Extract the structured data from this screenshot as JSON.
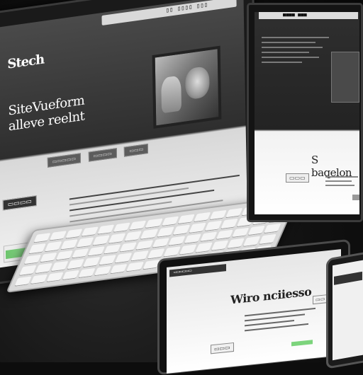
{
  "main_monitor": {
    "url_text": "▯▯ ▯▯▯▯ ▯▯▯",
    "logo": "Stech",
    "headline_1": "SiteVueform",
    "headline_2": "alleve reelnt",
    "buttons": [
      "▭▭▭▭▭",
      "▭▭▭▭",
      "▭▭▭"
    ],
    "nav_label": "▭▭▭▭"
  },
  "right_monitor": {
    "url_text": "■■■■ ■■■",
    "heading": "S baqelon",
    "badge": "▭▭▭"
  },
  "tablet": {
    "url_text": "▭▭▭▭▭▭",
    "heading": "Wiro nciiesso",
    "badge_left": "▭▭▭",
    "badge_right": "▭▭"
  }
}
